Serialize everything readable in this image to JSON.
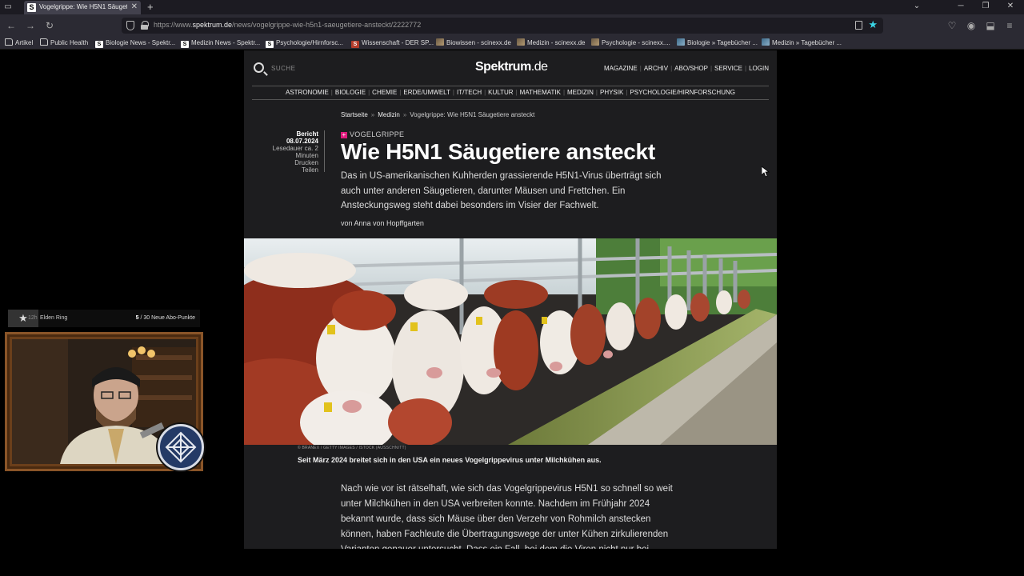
{
  "browser": {
    "tab_title": "Vogelgrippe: Wie H5N1 Säugeti",
    "tab_favicon": "S",
    "url_prefix": "https://www.",
    "url_domain": "spektrum.de",
    "url_path": "/news/vogelgrippe-wie-h5n1-saeugetiere-ansteckt/2222772",
    "bookmarks": [
      {
        "label": "Artikel",
        "icon": "folder-icon"
      },
      {
        "label": "Public Health",
        "icon": "folder-icon"
      },
      {
        "label": "Biologie News - Spektr...",
        "icon": "spektrum-favicon",
        "glyph": "S"
      },
      {
        "label": "Medizin News - Spektr...",
        "icon": "spektrum-favicon",
        "glyph": "S"
      },
      {
        "label": "Psychologie/Hirnforsc...",
        "icon": "spektrum-favicon",
        "glyph": "S"
      },
      {
        "label": "Wissenschaft - DER SP...",
        "icon": "spiegel-favicon",
        "glyph": "S"
      },
      {
        "label": "Biowissen - scinexx.de",
        "icon": "scinexx-favicon"
      },
      {
        "label": "Medizin - scinexx.de",
        "icon": "scinexx-favicon"
      },
      {
        "label": "Psychologie - scinexx....",
        "icon": "scinexx-favicon"
      },
      {
        "label": "Biologie » Tagebücher ...",
        "icon": "scilogs-favicon"
      },
      {
        "label": "Medizin » Tagebücher ...",
        "icon": "scilogs-favicon"
      }
    ]
  },
  "site": {
    "search_placeholder": "SUCHE",
    "logo_main": "Spektrum",
    "logo_suffix": ".de",
    "top_links": [
      "MAGAZINE",
      "ARCHIV",
      "ABO/SHOP",
      "SERVICE",
      "LOGIN"
    ],
    "categories": [
      "ASTRONOMIE",
      "BIOLOGIE",
      "CHEMIE",
      "ERDE/UMWELT",
      "IT/TECH",
      "KULTUR",
      "MATHEMATIK",
      "MEDIZIN",
      "PHYSIK",
      "PSYCHOLOGIE/HIRNFORSCHUNG"
    ]
  },
  "article": {
    "breadcrumb": [
      "Startseite",
      "Medizin",
      "Vogelgrippe: Wie H5N1 Säugetiere ansteckt"
    ],
    "type": "Bericht",
    "date": "08.07.2024",
    "reading_time": "Lesedauer ca. 2 Minuten",
    "print": "Drucken",
    "share": "Teilen",
    "kicker": "VOGELGRIPPE",
    "kicker_badge": "+",
    "headline": "Wie H5N1 Säugetiere ansteckt",
    "lead": "Das in US-amerikanischen Kuhherden grassierende H5N1-Virus überträgt sich auch unter anderen Säugetieren, darunter Mäusen und Frettchen. Ein Ansteckungsweg steht dabei besonders im Visier der Fachwelt.",
    "author": "von Anna von Hopffgarten",
    "image_credit": "© BRANEX / GETTY IMAGES / ISTOCK (AUSSCHNITT)",
    "caption": "Seit März 2024 breitet sich in den USA ein neues Vogelgrippevirus unter Milchkühen aus.",
    "body": "Nach wie vor ist rätselhaft, wie sich das Vogelgrippevirus H5N1 so schnell so weit unter Milchkühen in den USA verbreiten konnte. Nachdem im Frühjahr 2024 bekannt wurde, dass sich Mäuse über den Verzehr von Rohmilch anstecken können, haben Fachleute die Übertragungswege der unter Kühen zirkulierenden Varianten genauer untersucht. Dass ein Fall, bei dem die Viren nicht nur bei"
  },
  "overlay": {
    "rank": "12h",
    "game": "Elden Ring",
    "subs_current": "5",
    "subs_text": " / 30 Neue Abo-Punkte"
  },
  "colors": {
    "accent_star": "#3ad6e6",
    "kicker_badge": "#e0197d",
    "page_bg": "#1d1d1f"
  }
}
